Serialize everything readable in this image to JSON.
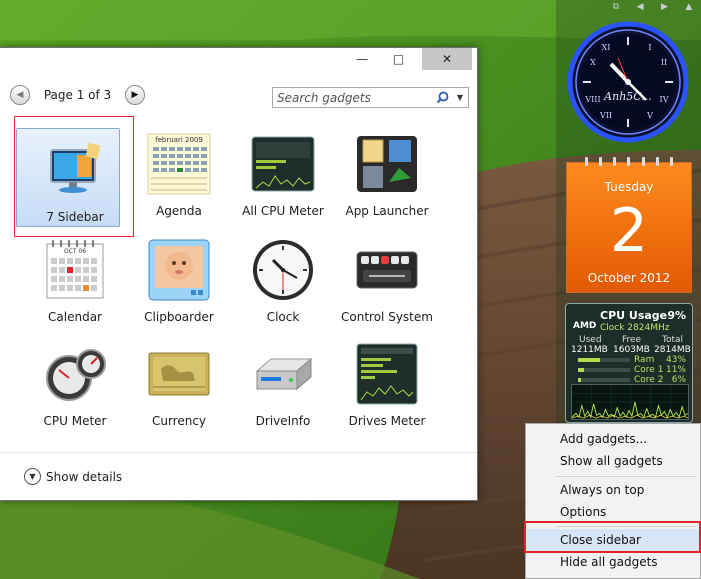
{
  "window": {
    "controls": {
      "minimize": "—",
      "maximize": "□",
      "close": "✕"
    }
  },
  "toolbar": {
    "page_label": "Page 1 of 3",
    "search_placeholder": "Search gadgets"
  },
  "gadgets": [
    {
      "label": "7 Sidebar",
      "icon": "sidebar-icon",
      "selected": true
    },
    {
      "label": "Agenda",
      "icon": "agenda-icon"
    },
    {
      "label": "All CPU Meter",
      "icon": "cpu-meter-icon"
    },
    {
      "label": "App Launcher",
      "icon": "app-launcher-icon"
    },
    {
      "label": "Calendar",
      "icon": "calendar-icon"
    },
    {
      "label": "Clipboarder",
      "icon": "clipboarder-icon"
    },
    {
      "label": "Clock",
      "icon": "clock-icon"
    },
    {
      "label": "Control System",
      "icon": "control-system-icon"
    },
    {
      "label": "CPU Meter",
      "icon": "cpu-gauge-icon"
    },
    {
      "label": "Currency",
      "icon": "currency-icon"
    },
    {
      "label": "DriveInfo",
      "icon": "drive-icon"
    },
    {
      "label": "Drives Meter",
      "icon": "drives-meter-icon"
    }
  ],
  "details": {
    "label": "Show details"
  },
  "sidebar": {
    "clock": {
      "brand": "Anh5C..."
    },
    "calendar": {
      "day": "Tuesday",
      "date": "2",
      "month": "October 2012"
    },
    "cpu": {
      "title": "CPU Usage",
      "percent": "9%",
      "brand": "AMD",
      "clock": "Clock 2824MHz",
      "mem_headers": [
        "Used",
        "Free",
        "Total"
      ],
      "mem_values": [
        "1211MB",
        "1603MB",
        "2814MB"
      ],
      "rows": [
        {
          "name": "Ram",
          "value": "43%",
          "level": 0.43
        },
        {
          "name": "Core 1",
          "value": "11%",
          "level": 0.11
        },
        {
          "name": "Core 2",
          "value": "6%",
          "level": 0.06
        }
      ]
    }
  },
  "context_menu": {
    "items": [
      "Add gadgets...",
      "Show all gadgets",
      "Always on top",
      "Options",
      "Close sidebar",
      "Hide all gadgets"
    ]
  },
  "colors": {
    "highlight": "#e2242a",
    "calendar_orange": "#f07414",
    "selection_blue": "#c6dcf6"
  }
}
